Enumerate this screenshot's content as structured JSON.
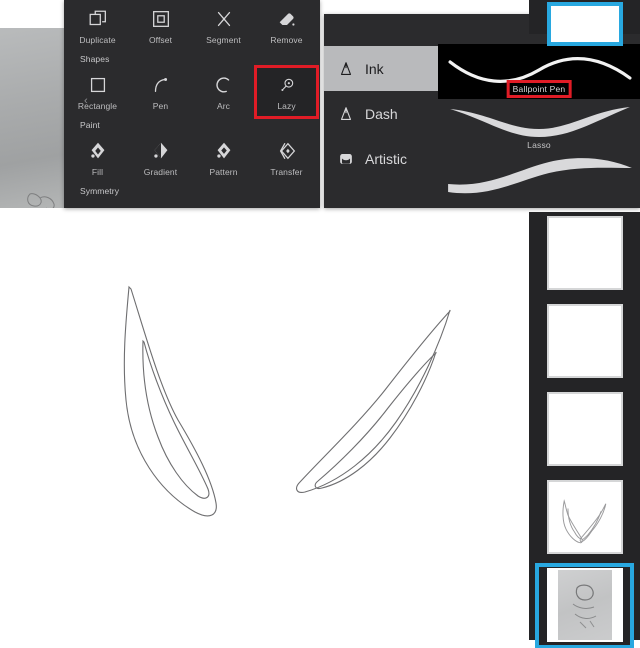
{
  "app": {
    "accent_blue": "#28a8e0",
    "highlight_red": "#e01c26",
    "panel_bg": "#2b2b2d",
    "canvas_bg": "#ffffff"
  },
  "tools_panel": {
    "back_chevron": "‹",
    "rows": [
      {
        "section": null,
        "items": [
          {
            "label": "Duplicate",
            "icon": "duplicate-icon",
            "highlighted": false
          },
          {
            "label": "Offset",
            "icon": "offset-icon",
            "highlighted": false
          },
          {
            "label": "Segment",
            "icon": "segment-icon",
            "highlighted": false
          },
          {
            "label": "Remove",
            "icon": "remove-eraser-icon",
            "highlighted": false
          }
        ]
      },
      {
        "section": "Shapes",
        "items": [
          {
            "label": "Rectangle",
            "icon": "rectangle-icon",
            "highlighted": false
          },
          {
            "label": "Pen",
            "icon": "pen-icon",
            "highlighted": false
          },
          {
            "label": "Arc",
            "icon": "arc-icon",
            "highlighted": false
          },
          {
            "label": "Lazy",
            "icon": "lazy-icon",
            "highlighted": true
          }
        ]
      },
      {
        "section": "Paint",
        "items": [
          {
            "label": "Fill",
            "icon": "fill-icon",
            "highlighted": false
          },
          {
            "label": "Gradient",
            "icon": "gradient-icon",
            "highlighted": false
          },
          {
            "label": "Pattern",
            "icon": "pattern-icon",
            "highlighted": false
          },
          {
            "label": "Transfer",
            "icon": "transfer-icon",
            "highlighted": false
          }
        ]
      }
    ],
    "footer_section": "Symmetry"
  },
  "brush_panel": {
    "settings_icon": "sliders-icon",
    "categories": [
      {
        "label": "Ink",
        "icon": "brush-nib-icon",
        "active": true
      },
      {
        "label": "Dash",
        "icon": "brush-nib-icon",
        "active": false
      },
      {
        "label": "Artistic",
        "icon": "paint-bucket-icon",
        "active": false
      }
    ],
    "brushes": [
      {
        "label": "Ballpoint Pen",
        "active": true
      },
      {
        "label": "Lasso",
        "active": false
      },
      {
        "label": "",
        "active": false
      }
    ]
  },
  "layers": {
    "items": [
      {
        "name": "layer-1",
        "content": "empty",
        "selected": false
      },
      {
        "name": "layer-2",
        "content": "empty",
        "selected": false
      },
      {
        "name": "layer-3",
        "content": "empty",
        "selected": false
      },
      {
        "name": "layer-4",
        "content": "ears-sketch",
        "selected": false
      },
      {
        "name": "layer-5",
        "content": "reference-photo",
        "selected": true
      }
    ]
  },
  "canvas": {
    "artwork": "two-ear-outlines",
    "reference_photo": "gray-paper-sketch"
  }
}
